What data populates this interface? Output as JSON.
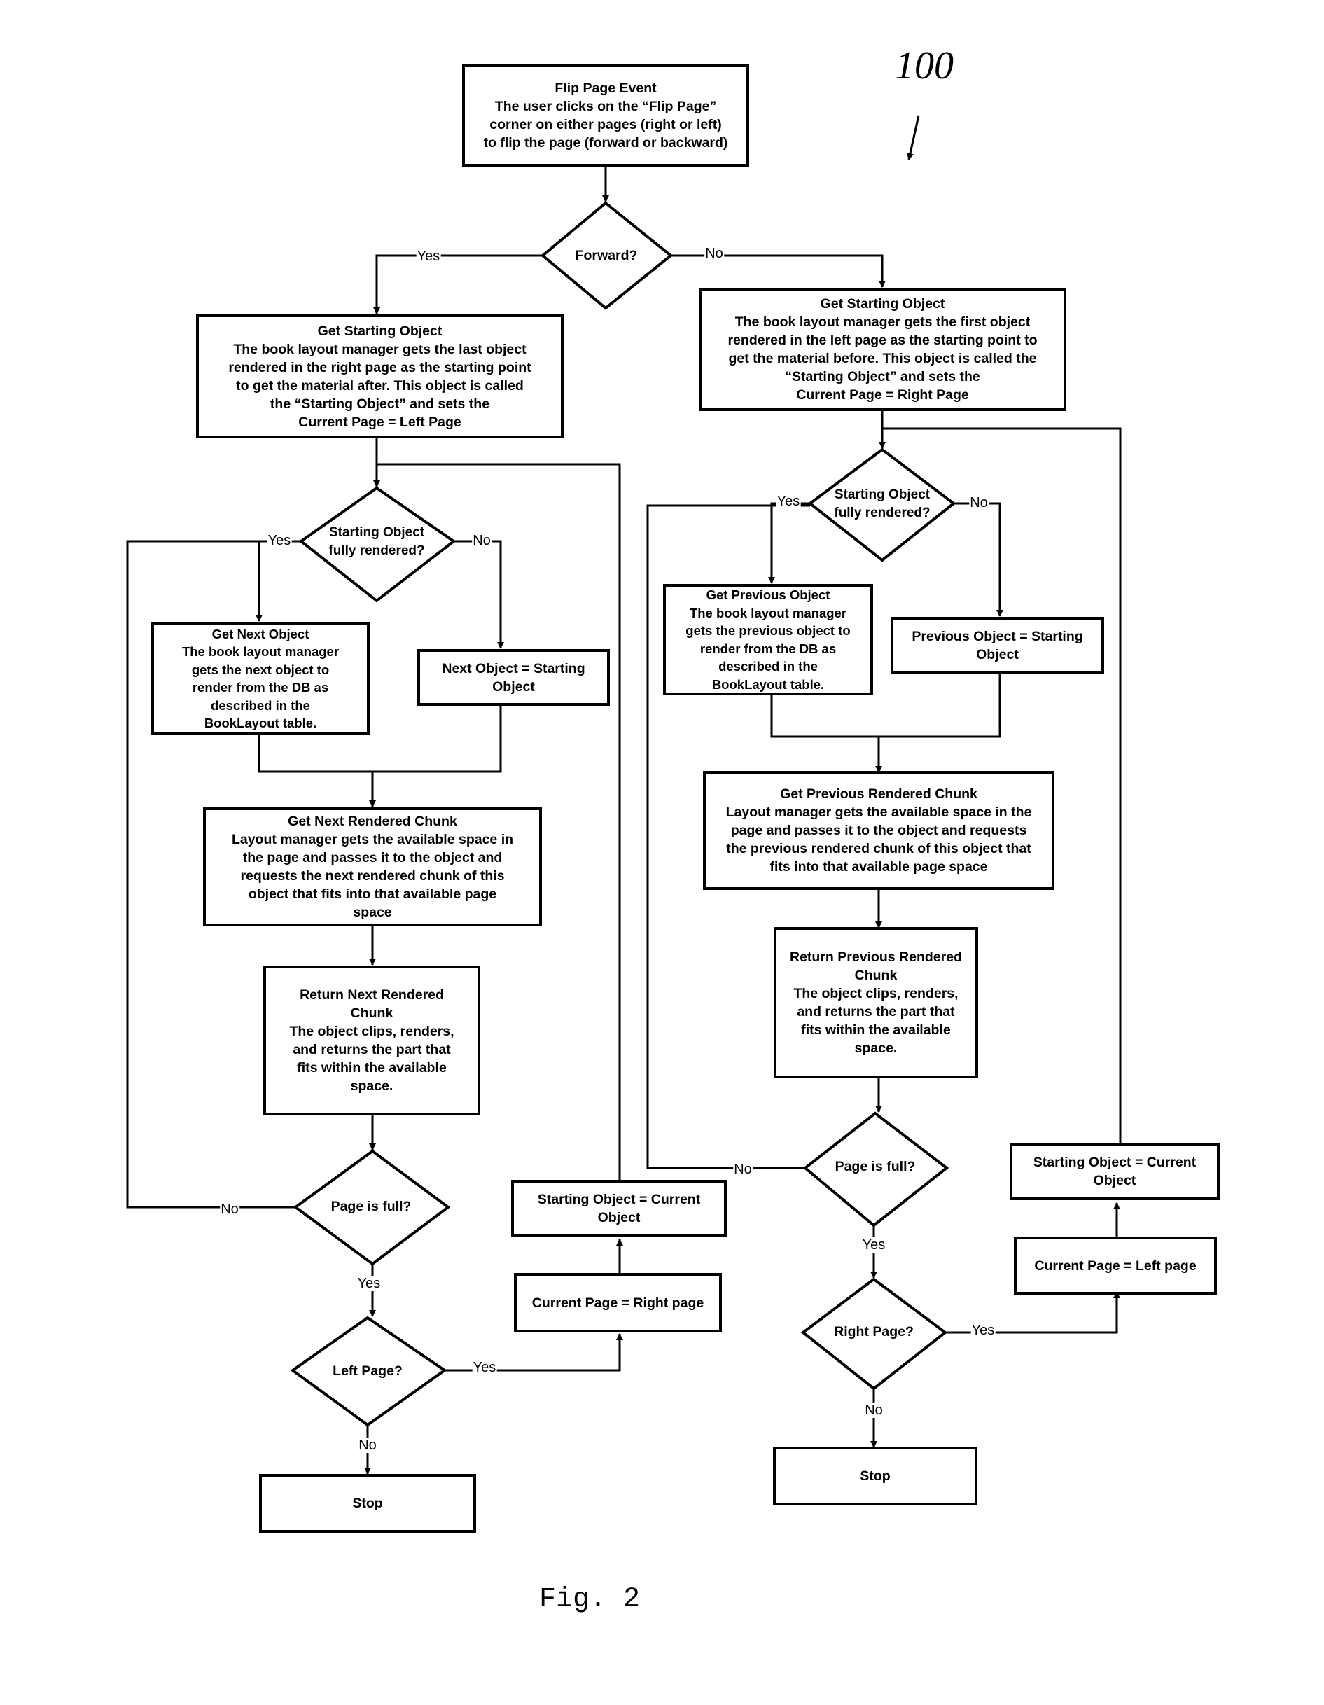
{
  "figure": {
    "reference_number": "100",
    "caption": "Fig. 2"
  },
  "nodes": {
    "flip_event": {
      "title": "Flip Page Event",
      "body": "The user clicks on the “Flip Page”\ncorner on either pages (right or left)\nto flip the page (forward or backward)"
    },
    "forward_decision": {
      "text": "Forward?"
    },
    "left_get_starting": {
      "title": "Get Starting Object",
      "body": "The book layout manager gets the last object\nrendered in the right page as the starting point\nto get the material after. This object is called\nthe “Starting Object” and sets the\nCurrent Page = Left Page"
    },
    "right_get_starting": {
      "title": "Get Starting Object",
      "body": "The book layout manager gets the first object\nrendered in the left page as the starting point to\nget the material before. This object is called the\n“Starting Object” and sets the\nCurrent Page = Right Page"
    },
    "left_fully_rendered": {
      "text": "Starting Object\nfully rendered?"
    },
    "right_fully_rendered": {
      "text": "Starting Object\nfully rendered?"
    },
    "get_next_object": {
      "title": "Get Next Object",
      "body": "The book layout manager\ngets the next object to\nrender from the DB as\ndescribed in the\nBookLayout table."
    },
    "next_equals_starting": {
      "title": "",
      "body": "Next Object = Starting\nObject"
    },
    "get_previous_object": {
      "title": "Get Previous Object",
      "body": "The book layout manager\ngets the previous object to\nrender from the DB as\ndescribed in the\nBookLayout table."
    },
    "previous_equals_starting": {
      "title": "",
      "body": "Previous Object = Starting\nObject"
    },
    "get_next_chunk": {
      "title": "Get Next Rendered Chunk",
      "body": "Layout manager gets the available space in\nthe page and passes it to the object and\nrequests the next rendered chunk of this\nobject that fits into that available page\nspace"
    },
    "get_previous_chunk": {
      "title": "Get Previous Rendered Chunk",
      "body": "Layout manager gets the available space in the\npage and passes it to the object and requests\nthe previous rendered chunk of this object that\nfits into that available page space"
    },
    "return_next_chunk": {
      "title": "Return Next Rendered\nChunk",
      "body": "The object clips, renders,\nand returns the part that\nfits within the available\nspace."
    },
    "return_previous_chunk": {
      "title": "Return Previous Rendered\nChunk",
      "body": "The object clips, renders,\nand returns the part that\nfits within the available\nspace."
    },
    "left_page_full": {
      "text": "Page is full?"
    },
    "right_page_full": {
      "text": "Page is full?"
    },
    "left_page_decision": {
      "text": "Left Page?"
    },
    "right_page_decision": {
      "text": "Right Page?"
    },
    "left_starting_equals_current": {
      "title": "",
      "body": "Starting Object = Current\nObject"
    },
    "left_current_page_right": {
      "title": "",
      "body": "Current Page = Right page"
    },
    "right_starting_equals_current": {
      "title": "",
      "body": "Starting Object = Current\nObject"
    },
    "right_current_page_left": {
      "title": "",
      "body": "Current Page = Left page"
    },
    "left_stop": {
      "title": "",
      "body": "Stop"
    },
    "right_stop": {
      "title": "",
      "body": "Stop"
    }
  },
  "edge_labels": {
    "forward_yes": "Yes",
    "forward_no": "No",
    "left_fully_yes": "Yes",
    "left_fully_no": "No",
    "right_fully_yes": "Yes",
    "right_fully_no": "No",
    "left_full_no": "No",
    "left_full_yes": "Yes",
    "right_full_no": "No",
    "right_full_yes": "Yes",
    "left_page_yes": "Yes",
    "left_page_no": "No",
    "right_page_yes": "Yes",
    "right_page_no": "No"
  }
}
